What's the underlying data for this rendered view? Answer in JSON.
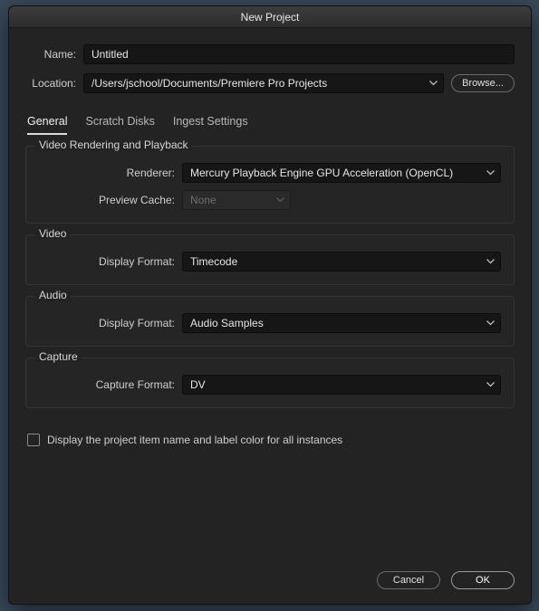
{
  "title": "New Project",
  "name": {
    "label": "Name:",
    "value": "Untitled"
  },
  "location": {
    "label": "Location:",
    "value": "/Users/jschool/Documents/Premiere Pro Projects",
    "browse": "Browse..."
  },
  "tabs": {
    "general": "General",
    "scratch": "Scratch Disks",
    "ingest": "Ingest Settings"
  },
  "groups": {
    "rendering": {
      "title": "Video Rendering and Playback",
      "renderer": {
        "label": "Renderer:",
        "value": "Mercury Playback Engine GPU Acceleration (OpenCL)"
      },
      "cache": {
        "label": "Preview Cache:",
        "value": "None"
      }
    },
    "video": {
      "title": "Video",
      "display": {
        "label": "Display Format:",
        "value": "Timecode"
      }
    },
    "audio": {
      "title": "Audio",
      "display": {
        "label": "Display Format:",
        "value": "Audio Samples"
      }
    },
    "capture": {
      "title": "Capture",
      "format": {
        "label": "Capture Format:",
        "value": "DV"
      }
    }
  },
  "checkbox_label": "Display the project item name and label color for all instances",
  "footer": {
    "cancel": "Cancel",
    "ok": "OK"
  }
}
